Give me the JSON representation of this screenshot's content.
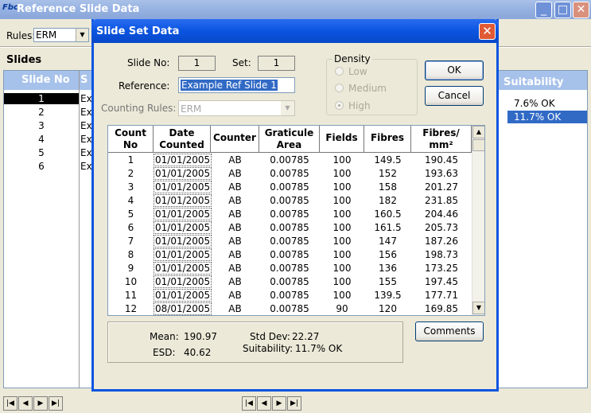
{
  "main": {
    "title": "Reference Slide Data",
    "icon_text": "Fbc",
    "rules_label": "Rules:",
    "rules_value": "ERM",
    "slides_label": "Slides",
    "columns": [
      "Slide No",
      "S",
      "Suitability"
    ],
    "slides": [
      {
        "no": "1",
        "name": "Ex"
      },
      {
        "no": "2",
        "name": "Ex"
      },
      {
        "no": "3",
        "name": "Ex"
      },
      {
        "no": "4",
        "name": "Ex"
      },
      {
        "no": "5",
        "name": "Ex"
      },
      {
        "no": "6",
        "name": "Ex"
      }
    ],
    "suitability": [
      "7.6% OK",
      "11.7% OK"
    ],
    "window_buttons": {
      "minimize": "_",
      "maximize": "□",
      "close": "✕"
    }
  },
  "dialog": {
    "title": "Slide Set Data",
    "close": "✕",
    "slide_no_label": "Slide No:",
    "slide_no": "1",
    "set_label": "Set:",
    "set": "1",
    "reference_label": "Reference:",
    "reference": "Example Ref Slide 1",
    "counting_rules_label": "Counting Rules:",
    "counting_rules": "ERM",
    "density": {
      "legend": "Density",
      "options": [
        "Low",
        "Medium",
        "High"
      ],
      "selected": "High"
    },
    "ok": "OK",
    "cancel": "Cancel",
    "comments": "Comments",
    "grid": {
      "headers": [
        "Count No",
        "Date Counted",
        "Counter",
        "Graticule Area",
        "Fields",
        "Fibres",
        "Fibres/ mm²"
      ],
      "rows": [
        [
          "1",
          "01/01/2005",
          "AB",
          "0.00785",
          "100",
          "149.5",
          "190.45"
        ],
        [
          "2",
          "01/01/2005",
          "AB",
          "0.00785",
          "100",
          "152",
          "193.63"
        ],
        [
          "3",
          "01/01/2005",
          "AB",
          "0.00785",
          "100",
          "158",
          "201.27"
        ],
        [
          "4",
          "01/01/2005",
          "AB",
          "0.00785",
          "100",
          "182",
          "231.85"
        ],
        [
          "5",
          "01/01/2005",
          "AB",
          "0.00785",
          "100",
          "160.5",
          "204.46"
        ],
        [
          "6",
          "01/01/2005",
          "AB",
          "0.00785",
          "100",
          "161.5",
          "205.73"
        ],
        [
          "7",
          "01/01/2005",
          "AB",
          "0.00785",
          "100",
          "147",
          "187.26"
        ],
        [
          "8",
          "01/01/2005",
          "AB",
          "0.00785",
          "100",
          "156",
          "198.73"
        ],
        [
          "9",
          "01/01/2005",
          "AB",
          "0.00785",
          "100",
          "136",
          "173.25"
        ],
        [
          "10",
          "01/01/2005",
          "AB",
          "0.00785",
          "100",
          "155",
          "197.45"
        ],
        [
          "11",
          "01/01/2005",
          "AB",
          "0.00785",
          "100",
          "139.5",
          "177.71"
        ],
        [
          "12",
          "08/01/2005",
          "AB",
          "0.00785",
          "90",
          "120",
          "169.85"
        ]
      ]
    },
    "stats": {
      "mean_label": "Mean:",
      "mean": "190.97",
      "esd_label": "ESD:",
      "esd": "40.62",
      "stddev_label": "Std Dev:",
      "stddev": "22.27",
      "suitability_label": "Suitability:",
      "suitability": "11.7% OK"
    }
  },
  "nav": {
    "first": "|◀",
    "prev": "◀",
    "next": "▶",
    "last": "▶|"
  }
}
